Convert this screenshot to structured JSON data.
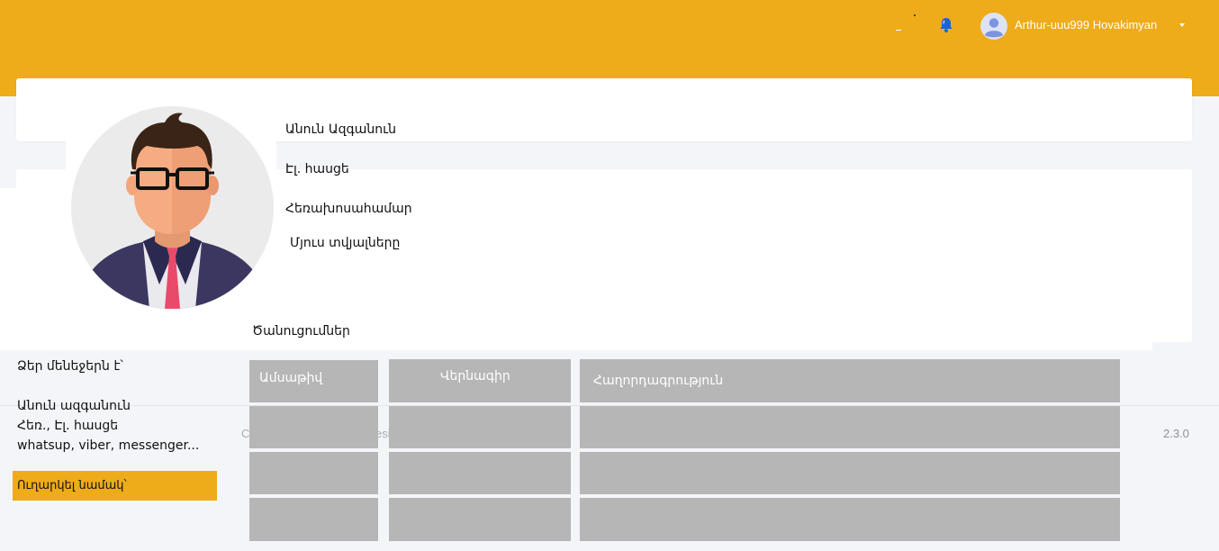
{
  "header": {
    "user_name": "Arthur-uuu999 Hovakimyan",
    "accent_color": "#eeab1a",
    "icons": [
      "bell-icon",
      "user-avatar-icon",
      "caret-down-icon"
    ]
  },
  "profile": {
    "full_name_label": "Անուն Ազգանուն",
    "email_label": "Էլ. հասցե",
    "phone_label": "Հեռախոսահամար",
    "other_data_label": "Մյուս տվյալները",
    "announcements_label": "Ծանուցումներ"
  },
  "sidebar": {
    "manager_heading": "Ձեր մենեջերն է՝",
    "manager_name": "Անուն ազգանուն",
    "manager_contacts": "Հեռ., Էլ. հասցե",
    "manager_messengers": "whatsup, viber, messenger...",
    "order_button": "Ուղարկել նամակ՝"
  },
  "table": {
    "headers": [
      "Ամսաթիվ",
      "Վերնագիր",
      "Հաղորդագրություն"
    ],
    "rows": [
      [
        "",
        "",
        ""
      ],
      [
        "",
        "",
        ""
      ],
      [
        "",
        "",
        ""
      ]
    ]
  },
  "footer": {
    "left_text": "C",
    "mid_text": "esi",
    "version": "2.3.0"
  }
}
